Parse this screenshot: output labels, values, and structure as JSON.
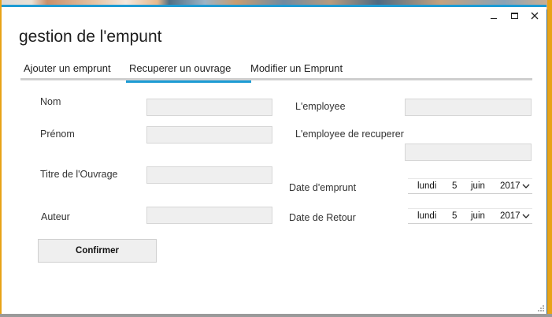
{
  "window": {
    "title": "gestion de l'empunt",
    "controls": [
      "minimize-icon",
      "maximize-icon",
      "close-icon"
    ]
  },
  "tabs": [
    {
      "label": "Ajouter un emprunt",
      "active": false
    },
    {
      "label": "Recuperer un ouvrage",
      "active": true
    },
    {
      "label": "Modifier  un Emprunt",
      "active": false
    }
  ],
  "form": {
    "left": {
      "nom_label": "Nom",
      "prenom_label": "Prénom",
      "titre_label": "Titre de l'Ouvrage",
      "auteur_label": "Auteur",
      "nom_value": "",
      "prenom_value": "",
      "titre_value": "",
      "auteur_value": ""
    },
    "right": {
      "employee_label": "L'employee",
      "employee_recup_label": "L'employee de recuperer",
      "date_emprunt_label": "Date d'emprunt",
      "date_retour_label": "Date de Retour",
      "employee_value": "",
      "employee_recup_value": ""
    },
    "date_emprunt": {
      "weekday": "lundi",
      "day": "5",
      "month": "juin",
      "year": "2017"
    },
    "date_retour": {
      "weekday": "lundi",
      "day": "5",
      "month": "juin",
      "year": "2017"
    },
    "confirm_label": "Confirmer"
  },
  "colors": {
    "accent": "#1c9bd4",
    "field_bg": "#efefef",
    "frame": "#e8a317"
  }
}
